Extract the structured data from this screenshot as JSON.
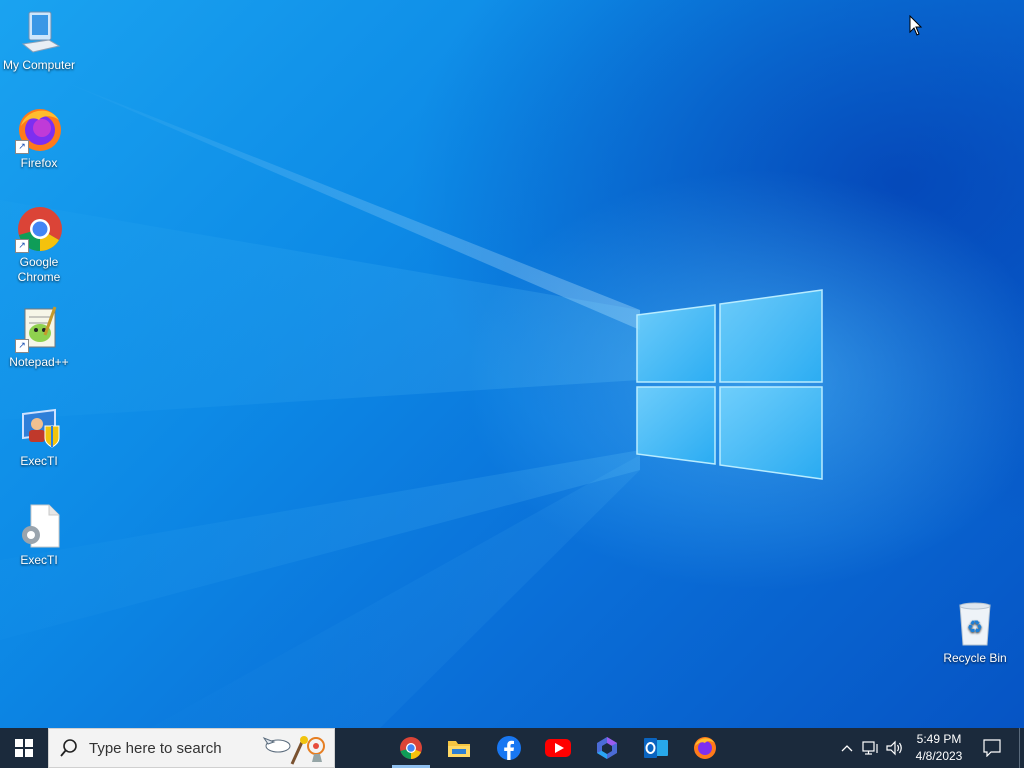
{
  "desktop": {
    "icons": [
      {
        "label": "My Computer",
        "icon": "computer-icon"
      },
      {
        "label": "Firefox",
        "icon": "firefox-icon"
      },
      {
        "label": "Google Chrome",
        "icon": "chrome-icon"
      },
      {
        "label": "Notepad++",
        "icon": "notepadpp-icon"
      },
      {
        "label": "ExecTI",
        "icon": "execti-admin-icon"
      },
      {
        "label": "ExecTI",
        "icon": "execti-file-icon"
      },
      {
        "label": "Recycle Bin",
        "icon": "recycle-bin-icon"
      }
    ]
  },
  "taskbar": {
    "search_placeholder": "Type here to search",
    "apps": [
      {
        "name": "Google Chrome",
        "icon": "chrome-icon",
        "active": true
      },
      {
        "name": "File Explorer",
        "icon": "folder-icon",
        "active": false
      },
      {
        "name": "Facebook",
        "icon": "facebook-icon",
        "active": false
      },
      {
        "name": "YouTube",
        "icon": "youtube-icon",
        "active": false
      },
      {
        "name": "Microsoft 365",
        "icon": "m365-icon",
        "active": false
      },
      {
        "name": "Outlook",
        "icon": "outlook-icon",
        "active": false
      },
      {
        "name": "Firefox",
        "icon": "firefox-icon",
        "active": false
      }
    ],
    "tray": {
      "time": "5:49 PM",
      "date": "4/8/2023"
    }
  },
  "colors": {
    "taskbar_bg": "#1b2a3c",
    "desktop_blue": "#0a6fd8",
    "chrome_red": "#db4437",
    "youtube_red": "#ff0000",
    "facebook_blue": "#1877f2"
  }
}
